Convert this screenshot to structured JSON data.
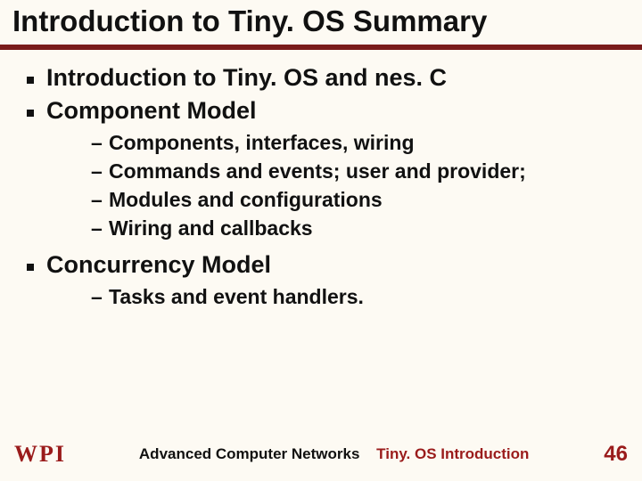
{
  "title": "Introduction to Tiny. OS Summary",
  "bullets": {
    "b0": "Introduction to Tiny. OS and nes. C",
    "b1": "Component Model",
    "b1_sub": [
      "Components, interfaces, wiring",
      "Commands and events; user and provider;",
      "Modules and configurations",
      "Wiring and callbacks"
    ],
    "b2": "Concurrency Model",
    "b2_sub": [
      "Tasks and event handlers."
    ]
  },
  "footer": {
    "logo_letters": {
      "w": "W",
      "p": "P",
      "i": "I"
    },
    "course": "Advanced Computer Networks",
    "topic": "Tiny. OS Introduction",
    "page": "46"
  }
}
